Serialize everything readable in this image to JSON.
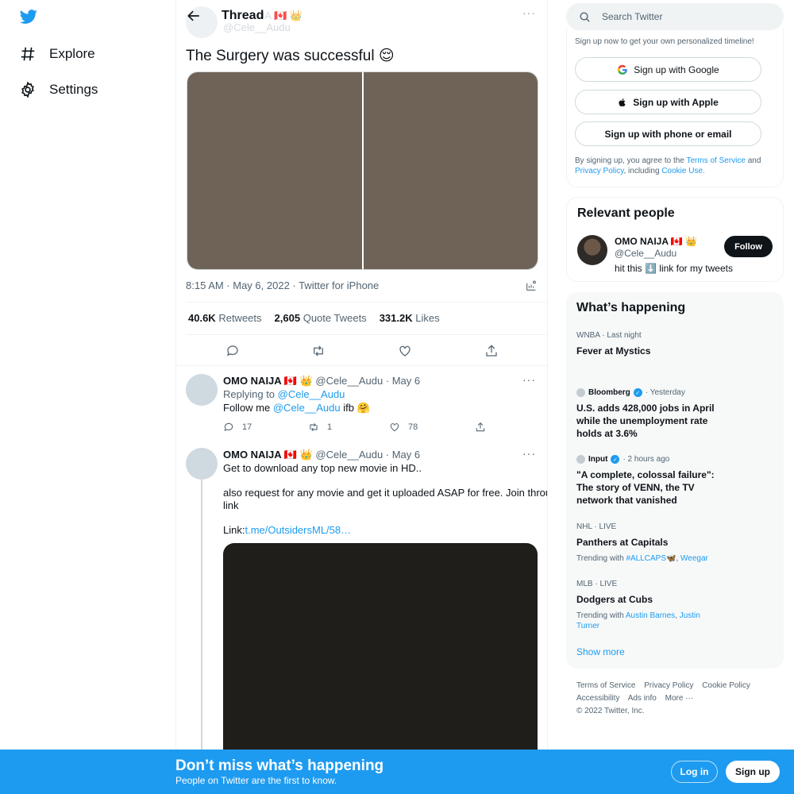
{
  "colors": {
    "accent": "#1d9bf0",
    "text": "#0f1419",
    "muted": "#536471",
    "banner": "#1d9bf0"
  },
  "nav": {
    "logo_icon": "twitter-bird-icon",
    "items": [
      {
        "label": "Explore",
        "icon": "hashtag-icon"
      },
      {
        "label": "Settings",
        "icon": "gear-icon"
      }
    ]
  },
  "thread": {
    "title": "Thread",
    "ghost_name": "UA 🇨🇦 👑",
    "ghost_handle": "@Cele__Audu",
    "tweet": {
      "text": "The Surgery was successful 😌",
      "meta": "8:15 AM · May 6, 2022 · Twitter for iPhone",
      "stats": [
        {
          "value": "40.6K",
          "label": "Retweets"
        },
        {
          "value": "2,605",
          "label": "Quote Tweets"
        },
        {
          "value": "331.2K",
          "label": "Likes"
        }
      ]
    },
    "replies": [
      {
        "name": "OMO NAIJA 🇨🇦 👑",
        "handle": "@Cele__Audu · May 6",
        "replying_prefix": "Replying to ",
        "replying_to": "@Cele__Audu",
        "text_a": "Follow me ",
        "mention": "@Cele__Audu",
        "text_b": " ifb 🤗",
        "reply_count": "17",
        "retweet_count": "1",
        "like_count": "78"
      },
      {
        "name": "OMO NAIJA 🇨🇦 👑",
        "handle": "@Cele__Audu · May 6",
        "line1": "Get to download any top new movie in HD..",
        "line2": "also request for any movie and get it uploaded ASAP for free. Join through",
        "line3": "link",
        "link_prefix": "Link:",
        "link": "t.me/OutsidersML/58…"
      }
    ]
  },
  "sidebar": {
    "search_placeholder": "Search Twitter",
    "signup": {
      "note": "Sign up now to get your own personalized timeline!",
      "google": "Sign up with Google",
      "apple": "Sign up with Apple",
      "phone": "Sign up with phone or email",
      "terms_a": "By signing up, you agree to the ",
      "terms_link1": "Terms of Service",
      "terms_b": " and ",
      "terms_link2": "Privacy Policy",
      "terms_c": ", including ",
      "terms_link3": "Cookie Use.",
      "terms_d": ""
    },
    "relevant": {
      "title": "Relevant people",
      "name": "OMO NAIJA 🇨🇦 👑",
      "handle": "@Cele__Audu",
      "bio": "hit this ⬇️ link for my tweets",
      "follow": "Follow"
    },
    "happening": {
      "title": "What’s happening",
      "trends": [
        {
          "context": "WNBA · Last night",
          "title": "Fever at Mystics"
        },
        {
          "source": "Bloomberg",
          "time": "· Yesterday",
          "title": "U.S. adds 428,000 jobs in April while the unemployment rate holds at 3.6%"
        },
        {
          "source": "Input",
          "time": "· 2 hours ago",
          "title": "\"A complete, colossal failure\": The story of VENN, the TV network that vanished"
        },
        {
          "context": "NHL · LIVE",
          "title": "Panthers at Capitals",
          "with_prefix": "Trending with ",
          "with_a": "#ALLCAPS🦋",
          "with_b": "Weegar"
        },
        {
          "context": "MLB · LIVE",
          "title": "Dodgers at Cubs",
          "with_prefix": "Trending with ",
          "with_a": "Austin Barnes",
          "with_b": "Justin Turner"
        }
      ],
      "show_more": "Show more"
    },
    "footer": {
      "links": [
        "Terms of Service",
        "Privacy Policy",
        "Cookie Policy",
        "Accessibility",
        "Ads info",
        "More ···"
      ],
      "copyright": "© 2022 Twitter, Inc."
    }
  },
  "banner": {
    "title": "Don’t miss what’s happening",
    "subtitle": "People on Twitter are the first to know.",
    "login": "Log in",
    "signup": "Sign up"
  }
}
